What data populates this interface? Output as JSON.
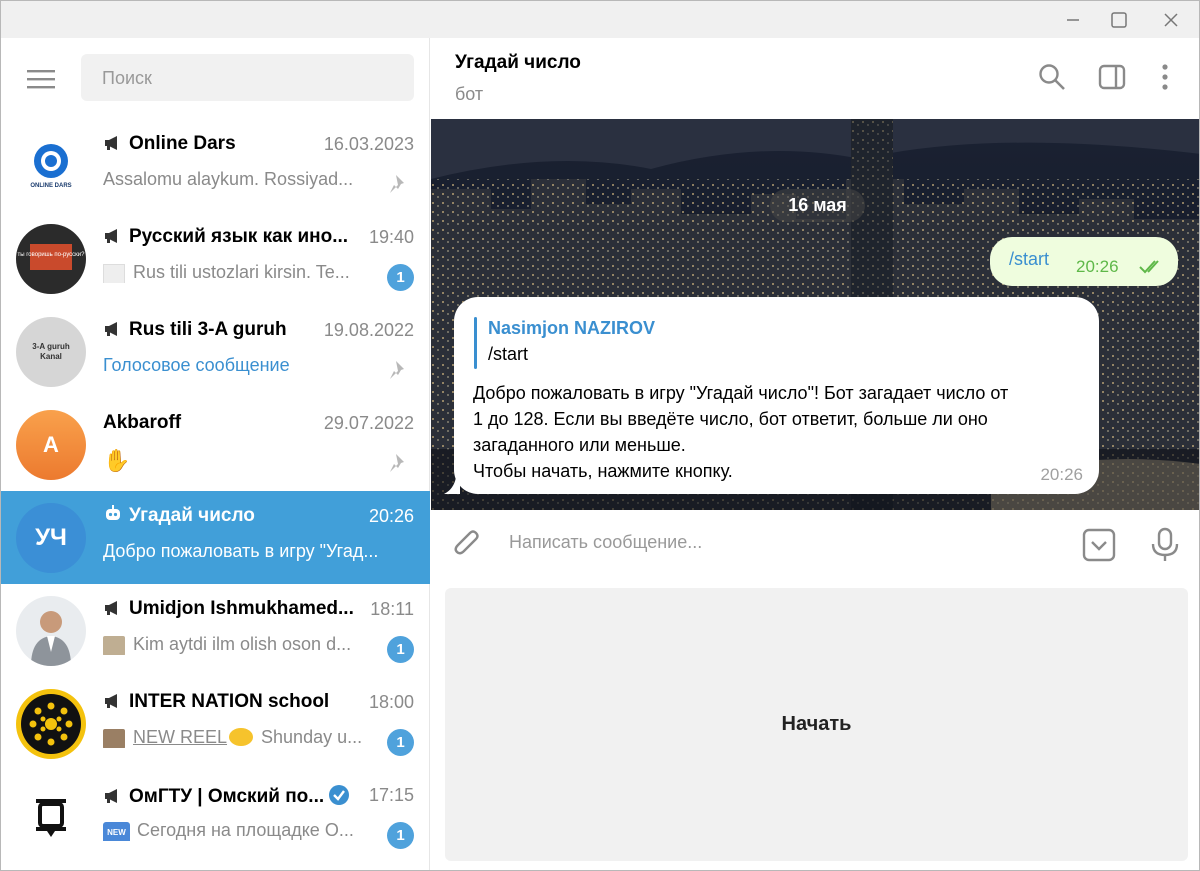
{
  "window": {
    "controls": [
      "minimize",
      "maximize",
      "close"
    ]
  },
  "sidebar": {
    "search_placeholder": "Поиск",
    "chats": [
      {
        "name": "Online Dars",
        "time": "16.03.2023",
        "preview": "Assalomu alaykum. Rossiyad...",
        "pinned": true,
        "channel": true,
        "avatar_text": "ONLINE DARS"
      },
      {
        "name": "Русский язык как ино...",
        "time": "19:40",
        "preview": "Rus tili ustozlari kirsin. Te...",
        "unread": "1",
        "channel": true,
        "avatar_text": "ты говоришь по-русски?"
      },
      {
        "name": "Rus tili 3-A guruh",
        "time": "19.08.2022",
        "preview": "Голосовое сообщение",
        "pinned": true,
        "channel": true,
        "avatar_text": "3-A guruh Kanal"
      },
      {
        "name": "Akbaroff",
        "time": "29.07.2022",
        "preview": "✋",
        "pinned": true,
        "avatar_text": "A"
      },
      {
        "name": "Угадай число",
        "time": "20:26",
        "preview": "Добро пожаловать в игру \"Угад...",
        "active": true,
        "bot": true,
        "avatar_text": "УЧ"
      },
      {
        "name": "Umidjon Ishmukhamed...",
        "time": "18:11",
        "preview": "Kim aytdi ilm olish oson d...",
        "unread": "1",
        "channel": true
      },
      {
        "name": "INTER NATION school",
        "time": "18:00",
        "preview_link": "NEW REEL",
        "preview": "Shunday u...",
        "unread": "1",
        "channel": true
      },
      {
        "name": "ОмГТУ | Омский по...",
        "time": "17:15",
        "preview": "Сегодня на площадке О...",
        "unread": "1",
        "channel": true,
        "verified": true
      }
    ]
  },
  "header": {
    "title": "Угадай число",
    "subtitle": "бот"
  },
  "messages": {
    "date": "16 мая",
    "outgoing": {
      "text": "/start",
      "time": "20:26"
    },
    "incoming": {
      "reply_name": "Nasimjon NAZIROV",
      "reply_text": "/start",
      "lines": [
        "Добро пожаловать в игру \"Угадай число\"! Бот загадает число от",
        "1 до 128. Если вы введёте число, бот ответит, больше ли оно",
        "загаданного или меньше.",
        "Чтобы начать, нажмите кнопку."
      ],
      "time": "20:26"
    }
  },
  "composer": {
    "placeholder": "Написать сообщение..."
  },
  "keyboard": {
    "button": "Начать"
  },
  "colors": {
    "accent": "#419fd9",
    "badge": "#4fa2dc",
    "outgoing_bubble": "#effdde",
    "link": "#3a8fd0"
  }
}
